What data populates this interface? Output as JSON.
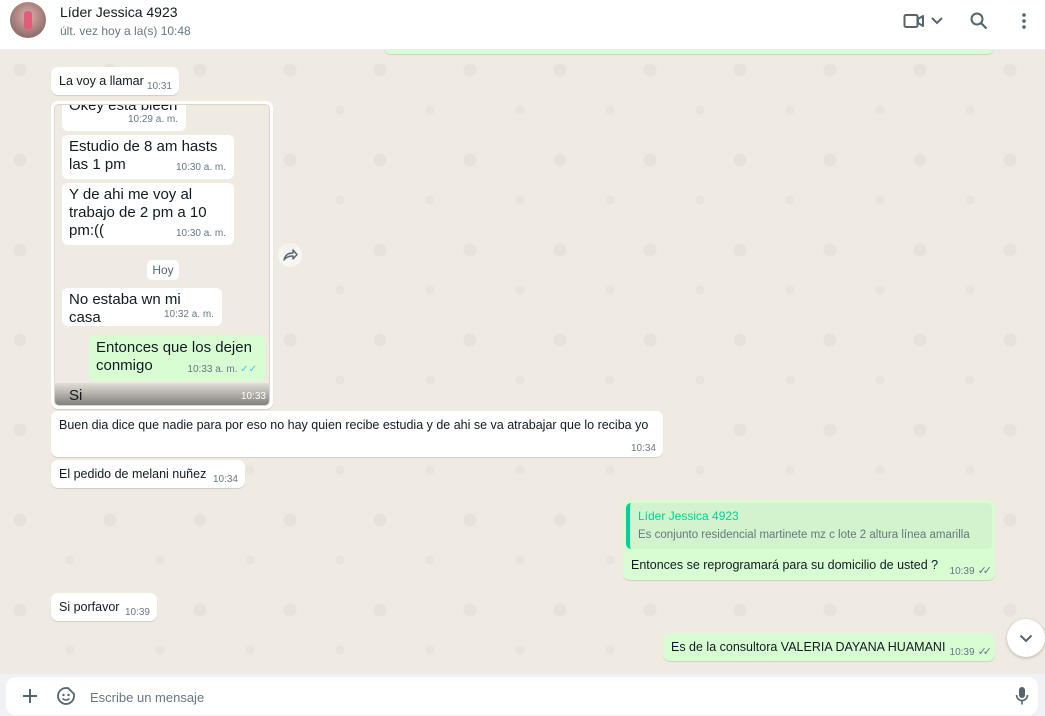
{
  "header": {
    "contact_name": "Líder Jessica 4923",
    "status": "últ. vez hoy a la(s) 10:48",
    "icons": [
      "video-call-icon",
      "chevron-down-icon",
      "search-icon",
      "menu-icon"
    ]
  },
  "messages": [
    {
      "dir": "in",
      "text": "La voy a llamar",
      "time": "10:31"
    },
    {
      "dir": "in",
      "type": "image",
      "time": "10:33"
    },
    {
      "dir": "in",
      "text": "Buen dia dice que nadie para por eso no hay quien recibe estudia y de ahi se va atrabajar que lo reciba yo",
      "time": "10:34"
    },
    {
      "dir": "in",
      "text": "El pedido de melani nuñez",
      "time": "10:34"
    },
    {
      "dir": "out",
      "quote_author": "Líder Jessica 4923",
      "quote_text": "Es conjunto residencial martinete mz c lote 2 altura línea amarilla",
      "text": "Entonces se reprogramará para su domicilio de usted ?",
      "time": "10:39"
    },
    {
      "dir": "in",
      "text": "Si porfavor",
      "time": "10:39"
    },
    {
      "dir": "out",
      "text": "Es de la consultora VALERIA DAYANA HUAMANI",
      "time": "10:39"
    }
  ],
  "image_content": {
    "m1_text": "Okey esta bieen",
    "m1_time": "10:29 a. m.",
    "m2_line1": "Estudio de 8 am hasts",
    "m2_line2": "las 1 pm",
    "m2_time": "10:30 a. m.",
    "m3_line1": "Y de ahi me voy al",
    "m3_line2": "trabajo de 2 pm a 10",
    "m3_line3": "pm:((",
    "m3_time": "10:30 a. m.",
    "day_label": "Hoy",
    "m4_text": "No estaba wn mi casa",
    "m4_time": "10:32 a. m.",
    "m5_line1": "Entonces que los dejen",
    "m5_line2": "conmigo",
    "m5_time": "10:33 a. m.",
    "m6_text": "Si"
  },
  "composer": {
    "placeholder": "Escribe un mensaje",
    "icons": [
      "plus-icon",
      "sticker-icon",
      "microphone-icon"
    ]
  },
  "colors": {
    "chat_bg": "#efeae2",
    "incoming": "#ffffff",
    "outgoing": "#d9fdd3",
    "quote_accent": "#06cf9c"
  }
}
